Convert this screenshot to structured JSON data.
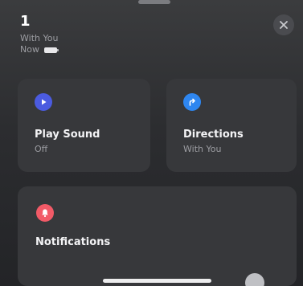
{
  "header": {
    "title": "1",
    "subtitle": "With You",
    "meta_label": "Now"
  },
  "actions": {
    "play_sound": {
      "label": "Play Sound",
      "status": "Off",
      "icon": "play-icon"
    },
    "directions": {
      "label": "Directions",
      "status": "With You",
      "icon": "directions-arrow-icon"
    }
  },
  "notifications": {
    "label": "Notifications",
    "icon": "bell-icon"
  },
  "colors": {
    "play_accent": "#4b5be0",
    "directions_accent": "#2e86f0",
    "notifications_accent": "#f25a67"
  }
}
